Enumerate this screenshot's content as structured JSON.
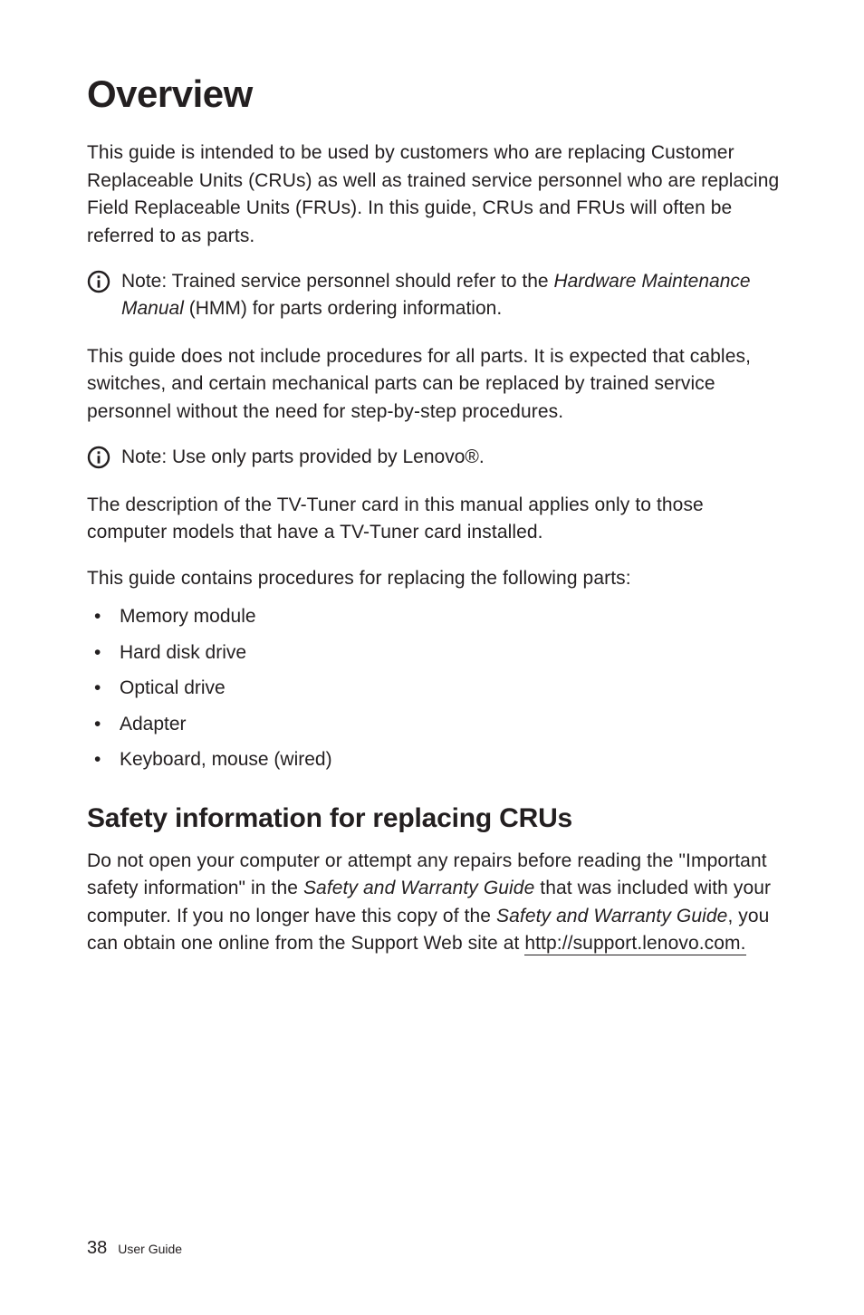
{
  "title": "Overview",
  "intro": "This guide is intended to be used by customers who are replacing Customer Replaceable Units (CRUs) as well as trained service personnel who are replacing Field Replaceable Units (FRUs). In this guide, CRUs and FRUs will often be referred to as parts.",
  "note1": {
    "prefix": "Note:",
    "lead": " Trained service personnel should refer to the ",
    "italic": "Hardware Maintenance Manual",
    "tail": " (HMM) for parts ordering information."
  },
  "para_noinclude": "This guide does not include procedures for all parts. It is expected that cables, switches, and certain mechanical parts can be replaced by trained service personnel without the need for step-by-step procedures.",
  "note2": {
    "prefix": "Note:",
    "text": " Use only parts provided by Lenovo®."
  },
  "para_tvtuner": "The description of the TV-Tuner card in this manual applies only to those computer models that have a TV-Tuner card installed.",
  "para_contains": "This guide contains procedures for replacing the following parts:",
  "bullets": [
    "Memory module",
    "Hard disk drive",
    "Optical drive",
    "Adapter",
    "Keyboard, mouse (wired)"
  ],
  "subhead": "Safety information for replacing CRUs",
  "safety": {
    "lead": "Do not open your computer or attempt any repairs before reading the \"Important safety information\" in the ",
    "italic1": "Safety and Warranty Guide",
    "mid": " that was included with your computer. If you no longer have this copy of the ",
    "italic2": "Safety and Warranty Guide",
    "tail": ", you can obtain one online from the Support Web site at ",
    "link_text": "http://support.lenovo.com."
  },
  "footer": {
    "page_num": "38",
    "label": "User Guide"
  }
}
